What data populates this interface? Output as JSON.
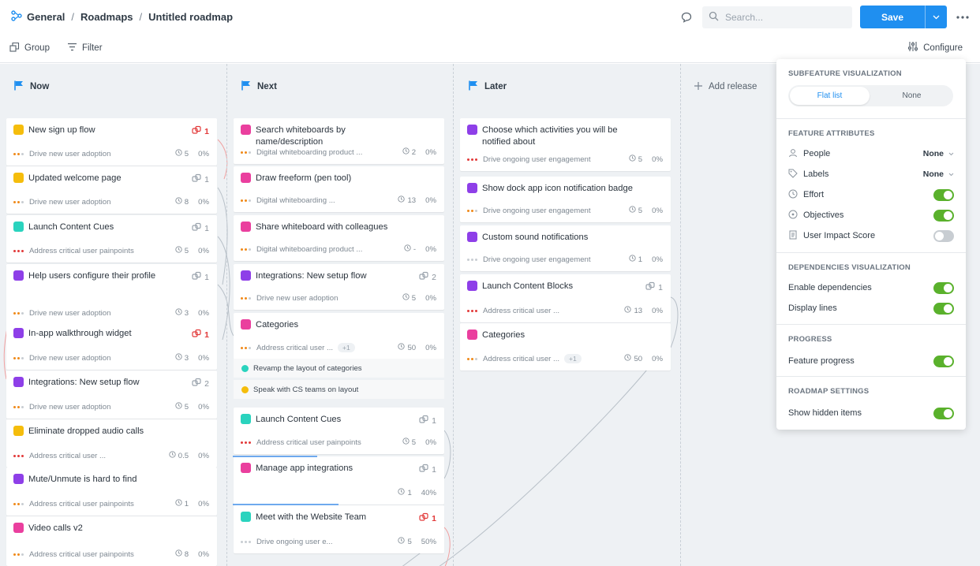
{
  "breadcrumbs": [
    "General",
    "Roadmaps",
    "Untitled roadmap"
  ],
  "search": {
    "placeholder": "Search..."
  },
  "save_label": "Save",
  "toolbar": {
    "group": "Group",
    "filter": "Filter",
    "configure": "Configure"
  },
  "colors": {
    "yellow": "#f5bd0c",
    "teal": "#2ad3be",
    "purple": "#8e3fe8",
    "pink": "#ea3f9e",
    "accent": "#1f8ff0",
    "green": "#5ab12c"
  },
  "columns": [
    {
      "name": "Now",
      "cards": [
        {
          "title": "New sign up flow",
          "color": "yellow",
          "dep": "1",
          "dep_red": true,
          "objective": "Drive new user adoption",
          "dots": "mixed",
          "effort": "5",
          "progress": "0%"
        },
        {
          "title": "Updated welcome page",
          "color": "yellow",
          "dep": "1",
          "dep_red": false,
          "objective": "Drive new user adoption",
          "dots": "mixed",
          "effort": "8",
          "progress": "0%"
        },
        {
          "title": "Launch Content Cues",
          "color": "teal",
          "dep": "1",
          "dep_red": false,
          "objective": "Address critical user painpoints",
          "dots": "red",
          "effort": "5",
          "progress": "0%"
        },
        {
          "title": "Help users configure their profile",
          "color": "purple",
          "dep": "1",
          "dep_red": false,
          "objective": "Drive new user adoption",
          "dots": "mixed",
          "effort": "3",
          "progress": "0%"
        },
        {
          "title": "In-app walkthrough widget",
          "color": "purple",
          "dep": "1",
          "dep_red": true,
          "objective": "Drive new user adoption",
          "dots": "mixed",
          "effort": "3",
          "progress": "0%"
        },
        {
          "title": "Integrations: New setup flow",
          "color": "purple",
          "dep": "2",
          "dep_red": false,
          "objective": "Drive new user adoption",
          "dots": "mixed",
          "effort": "5",
          "progress": "0%"
        },
        {
          "title": "Eliminate dropped audio calls",
          "color": "yellow",
          "dep": "",
          "dep_red": false,
          "objective": "Address critical user ...",
          "dots": "red",
          "effort": "0.5",
          "progress": "0%"
        },
        {
          "title": "Mute/Unmute is hard to find",
          "color": "purple",
          "dep": "",
          "dep_red": false,
          "objective": "Address critical user painpoints",
          "dots": "mixed",
          "effort": "1",
          "progress": "0%"
        },
        {
          "title": "Video calls v2",
          "color": "pink",
          "dep": "",
          "dep_red": false,
          "objective": "Address critical user painpoints",
          "dots": "mixed",
          "effort": "8",
          "progress": "0%"
        }
      ]
    },
    {
      "name": "Next",
      "cards": [
        {
          "title": "Search whiteboards by name/description",
          "color": "pink",
          "dep": "",
          "dep_red": false,
          "objective": "Digital whiteboarding product ...",
          "dots": "mixed",
          "effort": "2",
          "progress": "0%"
        },
        {
          "title": "Draw freeform (pen tool)",
          "color": "pink",
          "dep": "",
          "dep_red": false,
          "objective": "Digital whiteboarding ...",
          "dots": "mixed",
          "effort": "13",
          "progress": "0%"
        },
        {
          "title": "Share whiteboard with colleagues",
          "color": "pink",
          "dep": "",
          "dep_red": false,
          "objective": "Digital whiteboarding product ...",
          "dots": "mixed",
          "effort": "-",
          "progress": "0%"
        },
        {
          "title": "Integrations: New setup flow",
          "color": "purple",
          "dep": "2",
          "dep_red": false,
          "objective": "Drive new user adoption",
          "dots": "mixed",
          "effort": "5",
          "progress": "0%"
        },
        {
          "title": "Categories",
          "color": "pink",
          "dep": "",
          "dep_red": false,
          "objective": "Address critical user ...",
          "chip": "+1",
          "dots": "mixed",
          "effort": "50",
          "progress": "0%"
        },
        {
          "title": "Launch Content Cues",
          "color": "teal",
          "dep": "1",
          "dep_red": false,
          "objective": "Address critical user painpoints",
          "dots": "red",
          "effort": "5",
          "progress": "0%"
        },
        {
          "title": "Manage app integrations",
          "color": "pink",
          "dep": "1",
          "dep_red": false,
          "objective": "",
          "dots": "none",
          "effort": "1",
          "progress": "40%"
        },
        {
          "title": "Meet with the Website Team",
          "color": "teal",
          "dep": "1",
          "dep_red": true,
          "objective": "Drive ongoing user e...",
          "dots": "grey",
          "effort": "5",
          "progress": "50%"
        }
      ],
      "subfeatures": [
        {
          "title": "Revamp the layout of categories",
          "color": "teal"
        },
        {
          "title": "Speak with CS teams on layout",
          "color": "yellow"
        }
      ],
      "progress_bars": [
        0.4,
        0.5
      ]
    },
    {
      "name": "Later",
      "cards": [
        {
          "title": "Choose which activities you will be notified about",
          "color": "purple",
          "dep": "",
          "dep_red": false,
          "objective": "Drive ongoing user engagement",
          "dots": "red",
          "effort": "5",
          "progress": "0%"
        },
        {
          "title": "Show dock app icon notification badge",
          "color": "purple",
          "dep": "",
          "dep_red": false,
          "objective": "Drive ongoing user engagement",
          "dots": "mixed",
          "effort": "5",
          "progress": "0%"
        },
        {
          "title": "Custom sound notifications",
          "color": "purple",
          "dep": "",
          "dep_red": false,
          "objective": "Drive ongoing user engagement",
          "dots": "grey",
          "effort": "1",
          "progress": "0%"
        },
        {
          "title": "Launch Content Blocks",
          "color": "purple",
          "dep": "1",
          "dep_red": false,
          "objective": "Address critical user ...",
          "dots": "red",
          "effort": "13",
          "progress": "0%"
        },
        {
          "title": "Categories",
          "color": "pink",
          "dep": "",
          "dep_red": false,
          "objective": "Address critical user ...",
          "chip": "+1",
          "dots": "mixed",
          "effort": "50",
          "progress": "0%"
        }
      ]
    }
  ],
  "add_release": "Add release",
  "panel": {
    "subfeature_title": "SUBFEATURE VISUALIZATION",
    "seg_flat": "Flat list",
    "seg_none": "None",
    "attributes_title": "FEATURE ATTRIBUTES",
    "attributes": [
      {
        "label": "People",
        "icon": "person-icon",
        "value": "None",
        "toggle": null
      },
      {
        "label": "Labels",
        "icon": "tag-icon",
        "value": "None",
        "toggle": null
      },
      {
        "label": "Effort",
        "icon": "clock-icon",
        "value": null,
        "toggle": true
      },
      {
        "label": "Objectives",
        "icon": "target-icon",
        "value": null,
        "toggle": true
      },
      {
        "label": "User Impact Score",
        "icon": "document-icon",
        "value": null,
        "toggle": false
      }
    ],
    "dependencies_title": "DEPENDENCIES VISUALIZATION",
    "dependencies": [
      {
        "label": "Enable dependencies",
        "toggle": true
      },
      {
        "label": "Display lines",
        "toggle": true
      }
    ],
    "progress_title": "PROGRESS",
    "progress": [
      {
        "label": "Feature progress",
        "toggle": true
      }
    ],
    "settings_title": "ROADMAP SETTINGS",
    "settings": [
      {
        "label": "Show hidden items",
        "toggle": true
      }
    ]
  }
}
